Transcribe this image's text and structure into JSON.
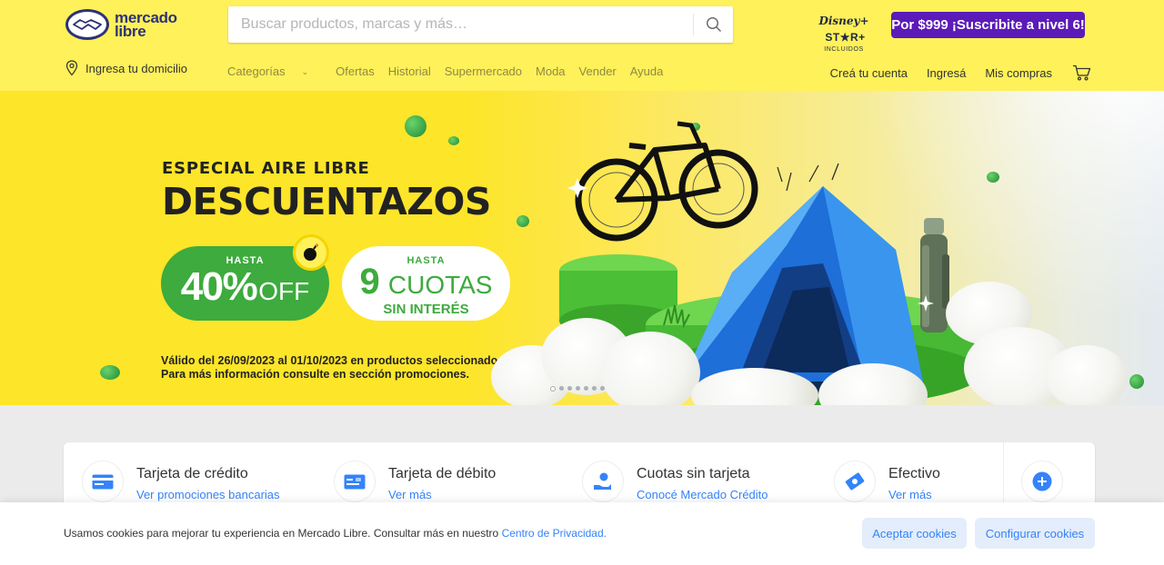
{
  "header": {
    "logo_line1": "mercado",
    "logo_line2": "libre",
    "search_placeholder": "Buscar productos, marcas y más…",
    "disney_brand": "Disney+",
    "star_brand": "ST★R+",
    "disney_caption": "INCLUIDOS",
    "promo_button": "Por $999 ¡Suscribite a nivel 6!",
    "address_label": "Ingresa tu domicilio",
    "nav": [
      "Categorías",
      "Ofertas",
      "Historial",
      "Supermercado",
      "Moda",
      "Vender",
      "Ayuda"
    ],
    "account": {
      "create": "Creá tu cuenta",
      "login": "Ingresá",
      "purchases": "Mis compras"
    }
  },
  "hero": {
    "kicker": "ESPECIAL AIRE LIBRE",
    "title": "DESCUENTAZOS",
    "offer_small": "HASTA",
    "offer_percent": "40%",
    "offer_word": "OFF",
    "cuotas_small": "HASTA",
    "cuotas_number": "9",
    "cuotas_word": "CUOTAS",
    "cuotas_sub": "SIN INTERÉS",
    "legal_line1": "Válido del 26/09/2023 al 01/10/2023 en productos seleccionados.",
    "legal_line2": "Para más información consulte en sección promociones.",
    "slides_total": 7,
    "slide_active": 1
  },
  "payments": [
    {
      "title": "Tarjeta de crédito",
      "link": "Ver promociones bancarias",
      "icon": "credit-card-icon"
    },
    {
      "title": "Tarjeta de débito",
      "link": "Ver más",
      "icon": "debit-card-icon"
    },
    {
      "title": "Cuotas sin tarjeta",
      "link": "Conocé Mercado Crédito",
      "icon": "hand-coin-icon"
    },
    {
      "title": "Efectivo",
      "link": "Ver más",
      "icon": "cash-icon"
    }
  ],
  "cookie": {
    "text": "Usamos cookies para mejorar tu experiencia en Mercado Libre. Consultar más en nuestro ",
    "link": "Centro de Privacidad.",
    "accept": "Aceptar cookies",
    "configure": "Configurar cookies"
  },
  "colors": {
    "header_bg": "#fff159",
    "accent_blue": "#3483fa",
    "promo_purple": "#5c1ab8",
    "offer_green": "#3dab3d"
  }
}
